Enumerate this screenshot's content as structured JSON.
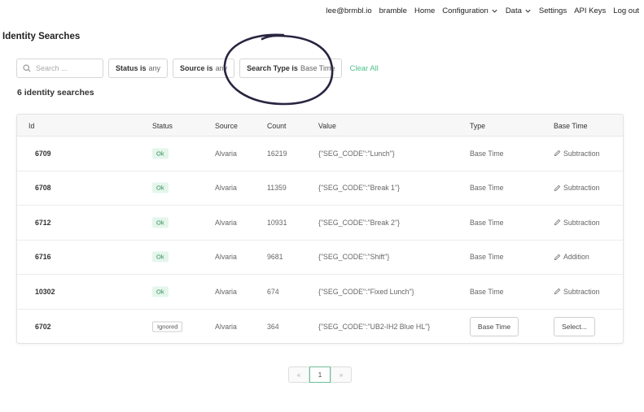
{
  "nav": {
    "email": "lee@brmbl.io",
    "org": "bramble",
    "home": "Home",
    "configuration": "Configuration",
    "data": "Data",
    "settings": "Settings",
    "api_keys": "API Keys",
    "logout": "Log out"
  },
  "page": {
    "title": "Identity Searches"
  },
  "filters": {
    "search_placeholder": "Search ...",
    "status_key": "Status is",
    "status_val": "any",
    "source_key": "Source is",
    "source_val": "any",
    "type_key": "Search Type is",
    "type_val": "Base Time",
    "clear_all": "Clear All"
  },
  "count_label": "6 identity searches",
  "table": {
    "headers": [
      "Id",
      "Status",
      "Source",
      "Count",
      "Value",
      "Type",
      "Base Time"
    ],
    "rows": [
      {
        "id": "6709",
        "status": "Ok",
        "source": "Alvaria",
        "count": "16219",
        "value": "{\"SEG_CODE\":\"Lunch\"}",
        "type": "Base Time",
        "base_time": "Subtraction"
      },
      {
        "id": "6708",
        "status": "Ok",
        "source": "Alvaria",
        "count": "11359",
        "value": "{\"SEG_CODE\":\"Break 1\"}",
        "type": "Base Time",
        "base_time": "Subtraction"
      },
      {
        "id": "6712",
        "status": "Ok",
        "source": "Alvaria",
        "count": "10931",
        "value": "{\"SEG_CODE\":\"Break 2\"}",
        "type": "Base Time",
        "base_time": "Subtraction"
      },
      {
        "id": "6716",
        "status": "Ok",
        "source": "Alvaria",
        "count": "9681",
        "value": "{\"SEG_CODE\":\"Shift\"}",
        "type": "Base Time",
        "base_time": "Addition"
      },
      {
        "id": "10302",
        "status": "Ok",
        "source": "Alvaria",
        "count": "674",
        "value": "{\"SEG_CODE\":\"Fixed Lunch\"}",
        "type": "Base Time",
        "base_time": "Subtraction"
      },
      {
        "id": "6702",
        "status": "Ignored",
        "source": "Alvaria",
        "count": "364",
        "value": "{\"SEG_CODE\":\"UB2-IH2 Blue HL\"}",
        "type_button": "Base Time",
        "base_time_button": "Select..."
      }
    ]
  },
  "pagination": {
    "prev": "«",
    "current": "1",
    "next": "»"
  },
  "colors": {
    "accent": "#4ec08a",
    "annotation": "#2a2440"
  }
}
